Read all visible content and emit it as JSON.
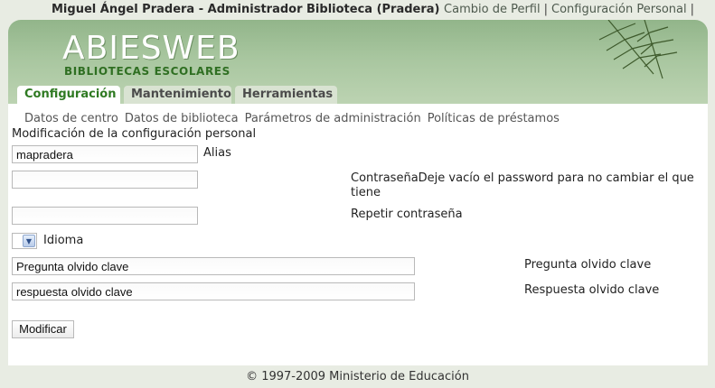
{
  "topbar": {
    "user": "Miguel Ángel Pradera - Administrador Biblioteca (Pradera)",
    "links": [
      "Cambio de Perfil",
      "Configuración Personal"
    ],
    "separator": "|"
  },
  "logo": {
    "title": "ABIESWEB",
    "subtitle": "BIBLIOTECAS ESCOLARES"
  },
  "tabs": [
    "Configuración",
    "Mantenimiento",
    "Herramientas"
  ],
  "subnav": [
    "Datos de centro",
    "Datos de biblioteca",
    "Parámetros de administración",
    "Políticas de préstamos"
  ],
  "form": {
    "title": "Modificación de la configuración personal",
    "alias": {
      "value": "mapradera",
      "label": "Alias"
    },
    "password": {
      "label_line1": "ContraseñaDeje vacío el password para no cambiar el que",
      "label_line2": "tiene"
    },
    "repeat_password": {
      "label": "Repetir contraseña"
    },
    "language": {
      "label": "Idioma",
      "arrow": "▼"
    },
    "question": {
      "value": "Pregunta olvido clave",
      "label": "Pregunta olvido clave"
    },
    "answer": {
      "value": "respuesta olvido clave",
      "label": "Respuesta olvido clave"
    },
    "submit": "Modificar"
  },
  "footer": "© 1997-2009 Ministerio de Educación"
}
